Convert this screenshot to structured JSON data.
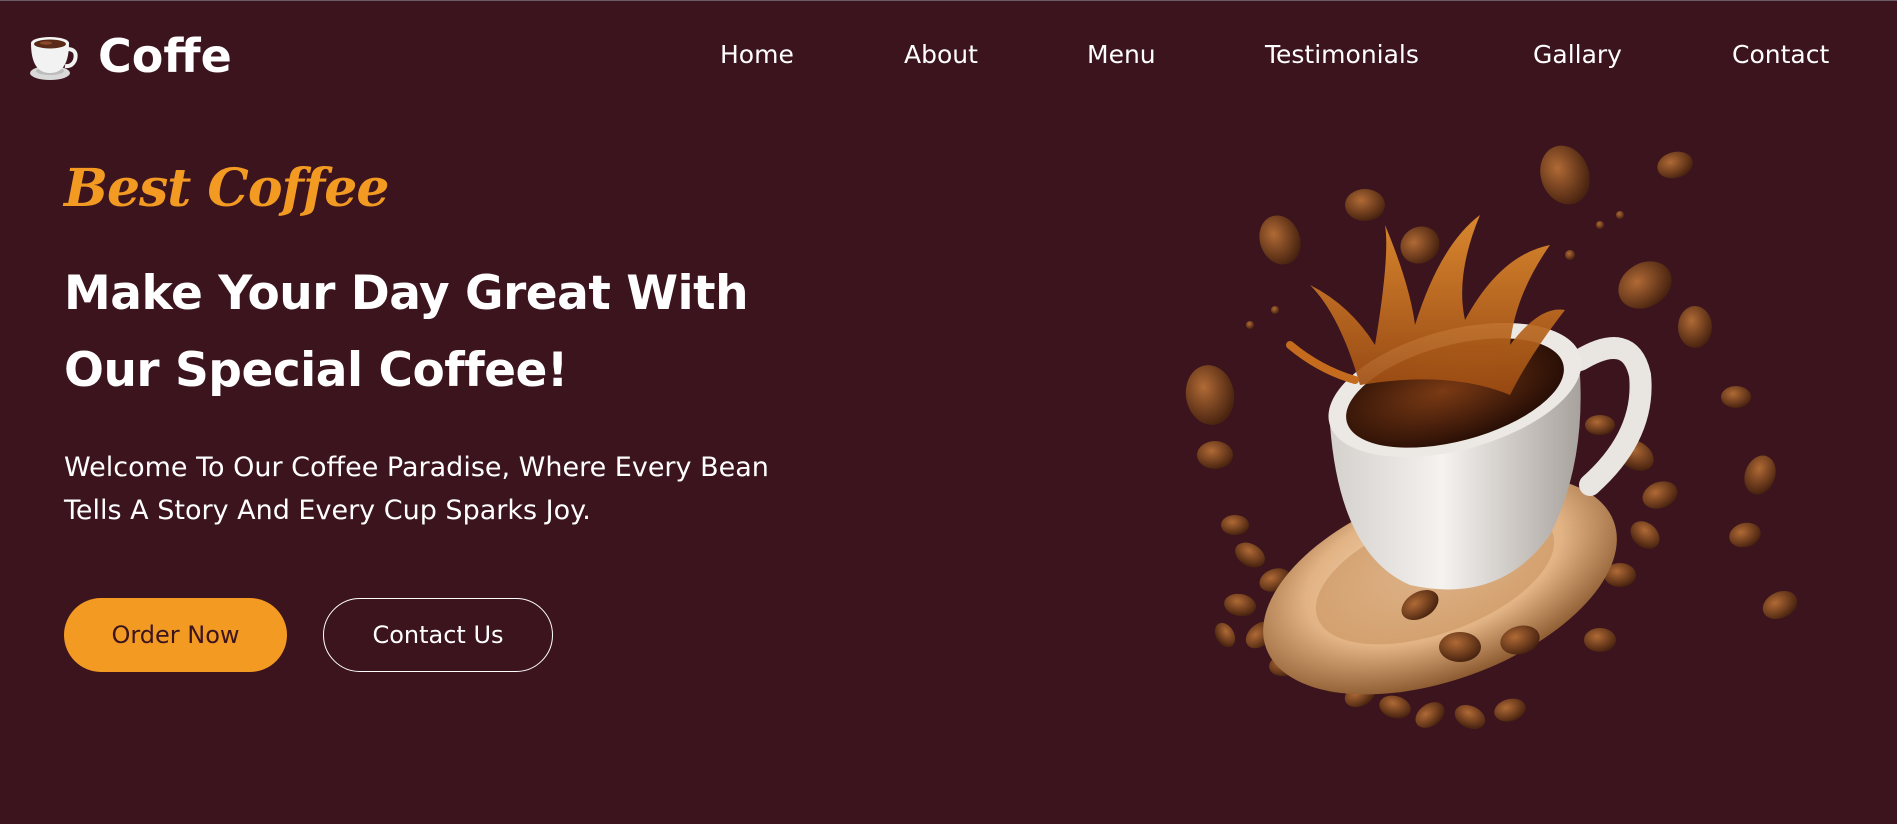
{
  "brand": {
    "name": "Coffe",
    "logo_icon": "coffee-cup-icon"
  },
  "nav": {
    "items": [
      {
        "label": "Home"
      },
      {
        "label": "About"
      },
      {
        "label": "Menu"
      },
      {
        "label": "Testimonials"
      },
      {
        "label": "Gallary"
      },
      {
        "label": "Contact"
      }
    ]
  },
  "hero": {
    "tagline": "Best Coffee",
    "headline_line1": "Make Your Day Great With",
    "headline_line2": "Our Special Coffee!",
    "description_line1": "Welcome To Our Coffee Paradise, Where Every Bean",
    "description_line2": "Tells A Story And Every Cup Sparks Joy.",
    "primary_button": "Order Now",
    "secondary_button": "Contact Us",
    "image": "coffee-cup-splash-with-beans"
  },
  "colors": {
    "background": "#3b141e",
    "accent": "#f29a22",
    "text": "#ffffff"
  }
}
